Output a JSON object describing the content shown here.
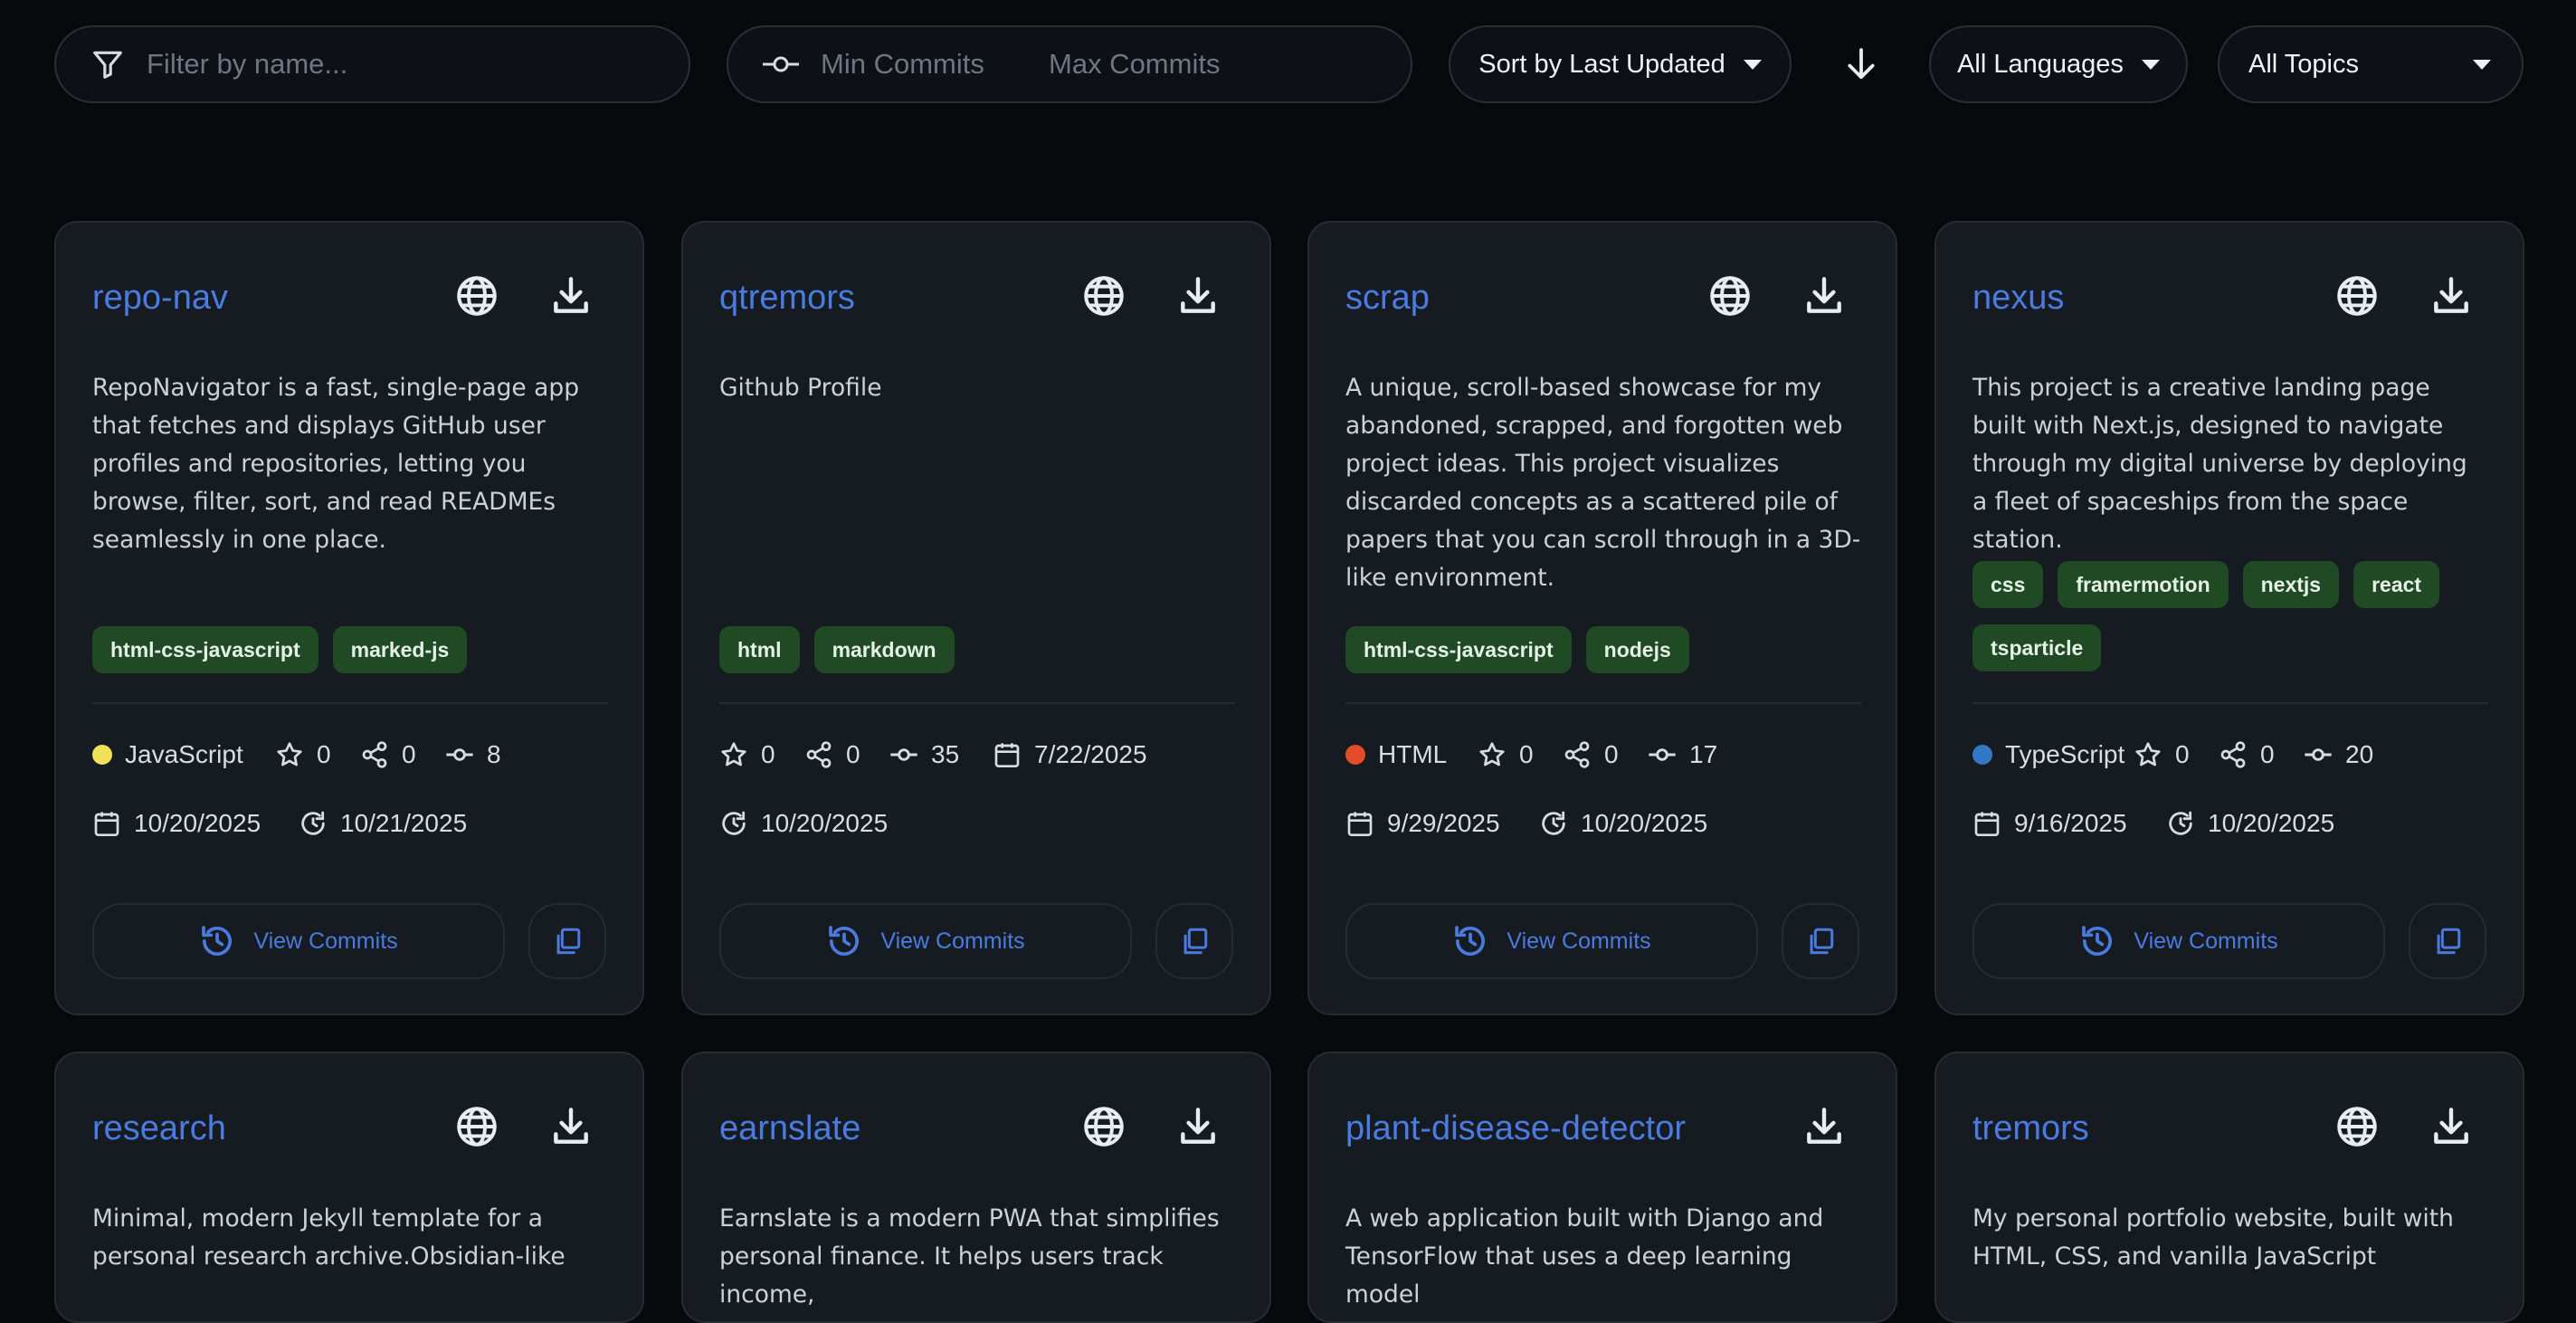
{
  "filters": {
    "name_placeholder": "Filter by name...",
    "min_commits_placeholder": "Min Commits",
    "max_commits_placeholder": "Max Commits",
    "sort_label": "Sort by Last Updated",
    "language_label": "All Languages",
    "topic_label": "All Topics"
  },
  "colors": {
    "background": "#07090d",
    "card": "#161b22",
    "accent": "#4a7be0",
    "tag": "#1f4a24",
    "javascript": "#f1e05a",
    "html": "#e34c26",
    "typescript": "#3178c6"
  },
  "view_commits_label": "View Commits",
  "repos": [
    {
      "name": "repo-nav",
      "description": "RepoNavigator is a fast, single-page app that fetches and displays GitHub user profiles and repositories, letting you browse, filter, sort, and read READMEs seamlessly in one place.",
      "topics": [
        "html-css-javascript",
        "marked-js"
      ],
      "language": "JavaScript",
      "stars": "0",
      "forks": "0",
      "commits": "8",
      "created": "10/20/2025",
      "updated": "10/21/2025"
    },
    {
      "name": "qtremors",
      "description": "Github Profile",
      "topics": [
        "html",
        "markdown"
      ],
      "stars": "0",
      "forks": "0",
      "commits": "35",
      "created": "7/22/2025",
      "updated": "10/20/2025"
    },
    {
      "name": "scrap",
      "description": "A unique, scroll-based showcase for my abandoned, scrapped, and forgotten web project ideas. This project visualizes discarded concepts as a scattered pile of papers that you can scroll through in a 3D-like environment.",
      "topics": [
        "html-css-javascript",
        "nodejs"
      ],
      "language": "HTML",
      "stars": "0",
      "forks": "0",
      "commits": "17",
      "created": "9/29/2025",
      "updated": "10/20/2025"
    },
    {
      "name": "nexus",
      "description": "This project is a creative landing page built with Next.js, designed to navigate through my digital universe by deploying a fleet of spaceships from the space station.",
      "topics": [
        "css",
        "framermotion",
        "nextjs",
        "react",
        "tsparticle"
      ],
      "language": "TypeScript",
      "stars": "0",
      "forks": "0",
      "commits": "20",
      "created": "9/16/2025",
      "updated": "10/20/2025"
    },
    {
      "name": "research",
      "description": "Minimal, modern Jekyll template for a personal research archive.Obsidian-like"
    },
    {
      "name": "earnslate",
      "description": "Earnslate is a modern PWA that simplifies personal finance. It helps users track income,"
    },
    {
      "name": "plant-disease-detector",
      "description": "A web application built with Django and TensorFlow that uses a deep learning model"
    },
    {
      "name": "tremors",
      "description": "My personal portfolio website, built with HTML, CSS, and vanilla JavaScript"
    }
  ]
}
